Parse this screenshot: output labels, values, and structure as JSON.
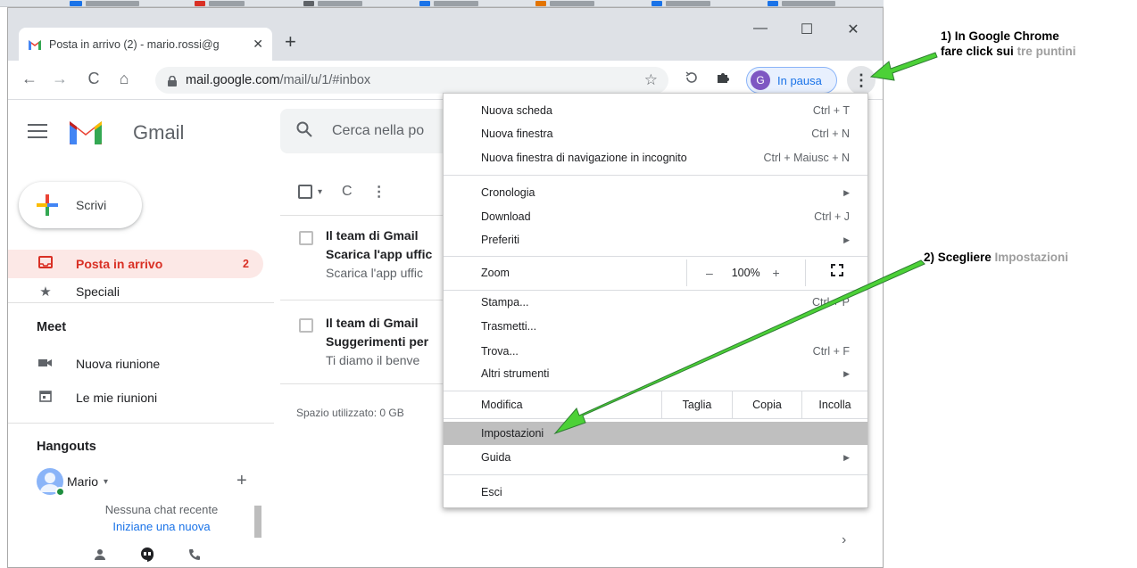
{
  "tab": {
    "title": "Posta in arrivo (2) - mario.rossi@g",
    "close": "✕",
    "new_tab": "+"
  },
  "window_controls": {
    "minimize": "—",
    "maximize": "☐",
    "close": "✕"
  },
  "toolbar": {
    "back": "←",
    "forward": "→",
    "reload": "C",
    "home": "⌂",
    "url_host": "mail.google.com",
    "url_path": "/mail/u/1/#inbox",
    "star": "☆",
    "profile_initial": "G",
    "profile_label": "In pausa",
    "menu_dots": "⋮"
  },
  "gmail": {
    "wordmark": "Gmail",
    "search_placeholder": "Cerca nella po",
    "compose": "Scrivi",
    "nav": [
      {
        "label": "Posta in arrivo",
        "count": "2",
        "icon": "inbox-icon"
      },
      {
        "label": "Speciali",
        "icon": "star-icon"
      }
    ],
    "meet": {
      "title": "Meet",
      "items": [
        {
          "label": "Nuova riunione",
          "icon": "video-icon"
        },
        {
          "label": "Le mie riunioni",
          "icon": "calendar-icon"
        }
      ]
    },
    "hangouts": {
      "title": "Hangouts",
      "user": "Mario",
      "caret": "▾",
      "add": "+",
      "no_chat": "Nessuna chat recente",
      "start_new": "Iniziane una nuova"
    },
    "list_toolbar": {
      "caret": "▾",
      "refresh": "C",
      "more": "⋮"
    },
    "mails": [
      {
        "from": "Il team di Gmail",
        "subject": "Scarica l'app uffic",
        "snippet": "Scarica l'app uffic"
      },
      {
        "from": "Il team di Gmail",
        "subject": "Suggerimenti per",
        "snippet": "Ti diamo il benve"
      }
    ],
    "storage": "Spazio utilizzato: 0 GB",
    "chevron": "›"
  },
  "menu": {
    "group1": [
      {
        "label": "Nuova scheda",
        "shortcut": "Ctrl + T"
      },
      {
        "label": "Nuova finestra",
        "shortcut": "Ctrl + N"
      },
      {
        "label": "Nuova finestra di navigazione in incognito",
        "shortcut": "Ctrl + Maiusc + N"
      }
    ],
    "group2": [
      {
        "label": "Cronologia",
        "submenu": "▶"
      },
      {
        "label": "Download",
        "shortcut": "Ctrl + J"
      },
      {
        "label": "Preferiti",
        "submenu": "▶"
      }
    ],
    "zoom": {
      "label": "Zoom",
      "minus": "–",
      "value": "100%",
      "plus": "+",
      "fullscreen": "⛶"
    },
    "group3": [
      {
        "label": "Stampa...",
        "shortcut": "Ctrl + P"
      },
      {
        "label": "Trasmetti..."
      },
      {
        "label": "Trova...",
        "shortcut": "Ctrl + F"
      },
      {
        "label": "Altri strumenti",
        "submenu": "▶"
      }
    ],
    "edit": {
      "label": "Modifica",
      "cut": "Taglia",
      "copy": "Copia",
      "paste": "Incolla"
    },
    "group4": [
      {
        "label": "Impostazioni"
      },
      {
        "label": "Guida",
        "submenu": "▶"
      }
    ],
    "exit": "Esci"
  },
  "annotations": {
    "step1_line1": "1) In Google Chrome",
    "step1_line2_prefix": "fare click sui ",
    "step1_line2_highlight": "tre puntini",
    "step2_prefix": "2) Scegliere ",
    "step2_highlight": "Impostazioni",
    "arrow_color": "#4cd137"
  }
}
